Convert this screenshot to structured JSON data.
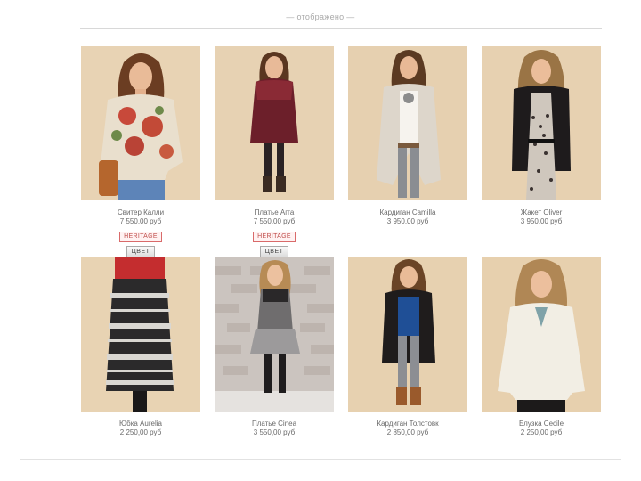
{
  "header": {
    "top_text": "— отображено —"
  },
  "products": [
    {
      "name": "Свитер Калли",
      "price": "7 550,00 руб",
      "badge": "HERITAGE",
      "color_button": "ЦВЕТ",
      "photo": "model-floral-sweater-jeans"
    },
    {
      "name": "Платье Агга",
      "price": "7 550,00 руб",
      "badge": "HERITAGE",
      "color_button": "ЦВЕТ",
      "photo": "model-burgundy-knit-dress"
    },
    {
      "name": "Кардиган Camilla",
      "price": "3 950,00 руб",
      "photo": "model-cream-waterfall-cardigan"
    },
    {
      "name": "Жакет Oliver",
      "price": "3 950,00 руб",
      "photo": "model-black-jacket-print-dress"
    },
    {
      "name": "Юбка Aurelia",
      "price": "2 250,00 руб",
      "photo": "model-fairisle-maxi-skirt"
    },
    {
      "name": "Платье Cinea",
      "price": "3 550,00 руб",
      "photo": "model-grey-knit-dress-brick-wall"
    },
    {
      "name": "Кардиган Толстовк",
      "price": "2 850,00 руб",
      "photo": "model-long-black-cardigan"
    },
    {
      "name": "Блузка Cecile",
      "price": "2 250,00 руб",
      "photo": "model-cream-blouse"
    }
  ],
  "colors": {
    "backdrop": "#e6cfae",
    "badge_text": "#c0504d",
    "badge_border": "#d96a6a",
    "brick_wall": "#cbc4bf"
  }
}
